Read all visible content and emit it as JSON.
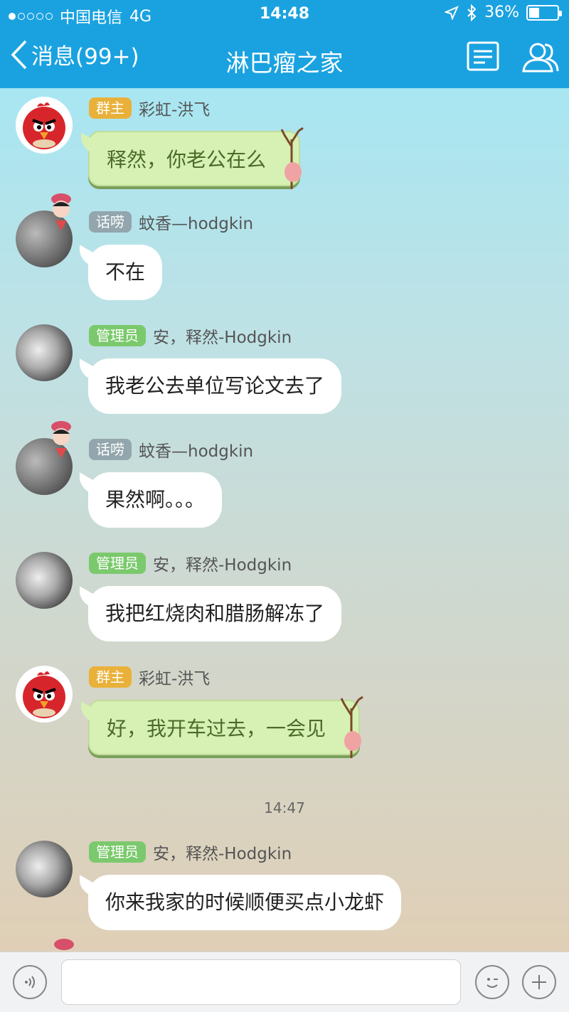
{
  "status_bar": {
    "carrier": "中国电信",
    "network": "4G",
    "time": "14:48",
    "battery": "36%",
    "battery_level": 0.36
  },
  "nav": {
    "back_label": "消息(99+)",
    "title": "淋巴瘤之家"
  },
  "messages": [
    {
      "role": "群主",
      "sender": "彩虹-洪飞",
      "text": "释然，你老公在么",
      "style": "green"
    },
    {
      "role": "话唠",
      "sender": "蚊香—hodgkin",
      "text": "不在",
      "style": "white"
    },
    {
      "role": "管理员",
      "sender": "安，释然-Hodgkin",
      "text": "我老公去单位写论文去了",
      "style": "white"
    },
    {
      "role": "话唠",
      "sender": "蚊香—hodgkin",
      "text": "果然啊。。。",
      "style": "white"
    },
    {
      "role": "管理员",
      "sender": "安，释然-Hodgkin",
      "text": "我把红烧肉和腊肠解冻了",
      "style": "white"
    },
    {
      "role": "群主",
      "sender": "彩虹-洪飞",
      "text": "好，我开车过去，一会见",
      "style": "green"
    },
    {
      "role": "管理员",
      "sender": "安，释然-Hodgkin",
      "text": "你来我家的时候顺便买点小龙虾",
      "style": "white"
    }
  ],
  "time_separator": "14:47",
  "input": {
    "value": "",
    "placeholder": ""
  },
  "colors": {
    "accent": "#1aa2e0",
    "owner_badge": "#e9b13a",
    "talk_badge": "#93a6ad",
    "admin_badge": "#7bc96d"
  }
}
